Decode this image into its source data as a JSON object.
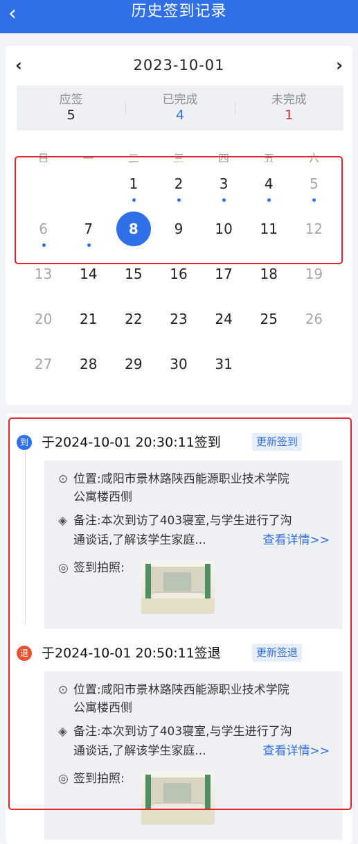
{
  "header": {
    "back_icon": "‹",
    "title": "历史签到记录"
  },
  "calendar": {
    "prev": "‹",
    "next": "›",
    "month": "2023-10-01",
    "stats": [
      {
        "label": "应签",
        "value": "5",
        "color": "#222222"
      },
      {
        "label": "已完成",
        "value": "4",
        "color": "#2f6fe7"
      },
      {
        "label": "未完成",
        "value": "1",
        "color": "#e5232c"
      }
    ],
    "weekdays": [
      "日",
      "一",
      "二",
      "三",
      "四",
      "五",
      "六"
    ],
    "weeks": [
      [
        {
          "d": ""
        },
        {
          "d": ""
        },
        {
          "d": "1",
          "dot": true
        },
        {
          "d": "2",
          "dot": true
        },
        {
          "d": "3",
          "dot": true
        },
        {
          "d": "4",
          "dot": true
        },
        {
          "d": "5",
          "dot": true,
          "dim": true
        }
      ],
      [
        {
          "d": "6",
          "dot": true,
          "dim": true
        },
        {
          "d": "7",
          "dot": true
        },
        {
          "d": "8",
          "sel": true
        },
        {
          "d": "9"
        },
        {
          "d": "10"
        },
        {
          "d": "11"
        },
        {
          "d": "12",
          "dim": true
        }
      ],
      [
        {
          "d": "13",
          "dim": true
        },
        {
          "d": "14"
        },
        {
          "d": "15"
        },
        {
          "d": "16"
        },
        {
          "d": "17"
        },
        {
          "d": "18"
        },
        {
          "d": "19",
          "dim": true
        }
      ],
      [
        {
          "d": "20",
          "dim": true
        },
        {
          "d": "21"
        },
        {
          "d": "22"
        },
        {
          "d": "23"
        },
        {
          "d": "24"
        },
        {
          "d": "25"
        },
        {
          "d": "26",
          "dim": true
        }
      ],
      [
        {
          "d": "27",
          "dim": true
        },
        {
          "d": "28"
        },
        {
          "d": "29"
        },
        {
          "d": "30"
        },
        {
          "d": "31"
        },
        {
          "d": ""
        },
        {
          "d": ""
        }
      ]
    ]
  },
  "records": [
    {
      "badge": "到",
      "badge_color": "#2f6fe7",
      "heading": "于2024-10-01 20:30:11签到",
      "action": "更新签到",
      "location_line1": "位置:咸阳市景林路陕西能源职业技术学院",
      "location_line2": "公寓楼西侧",
      "note_line1": "备注:本次到访了403寝室,与学生进行了沟",
      "note_line2": "通谈话,了解该学生家庭...",
      "more": "查看详情>>",
      "photo_label": "签到拍照:"
    },
    {
      "badge": "退",
      "badge_color": "#e8522d",
      "heading": "于2024-10-01 20:50:11签退",
      "action": "更新签退",
      "location_line1": "位置:咸阳市景林路陕西能源职业技术学院",
      "location_line2": "公寓楼西侧",
      "note_line1": "备注:本次到访了403寝室,与学生进行了沟",
      "note_line2": "通谈话,了解该学生家庭...",
      "more": "查看详情>>",
      "photo_label": "签到拍照:"
    }
  ],
  "icons": {
    "location": "location-pin-icon",
    "note": "tag-icon",
    "camera": "camera-icon"
  }
}
